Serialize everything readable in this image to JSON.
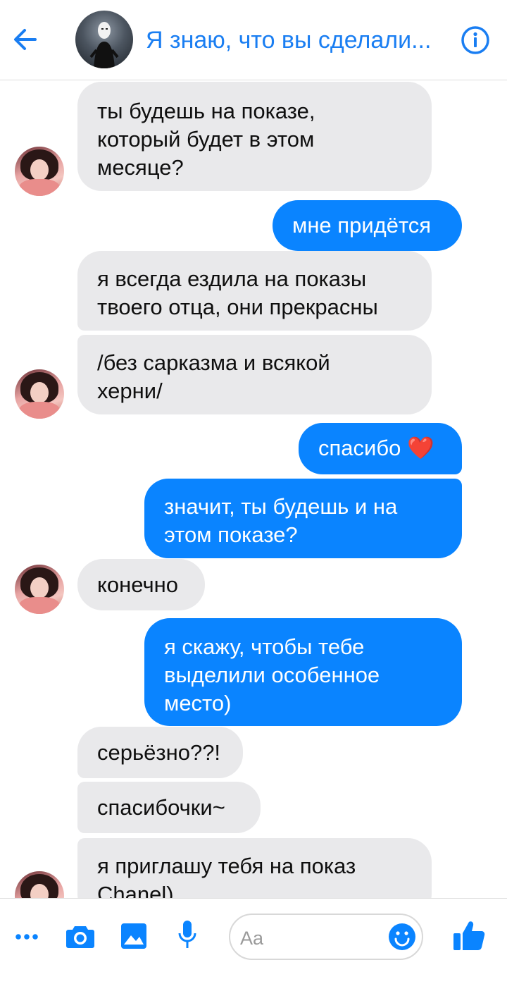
{
  "header": {
    "title": "Я знаю, что вы сделали..."
  },
  "icons": {
    "back": "arrow-left-icon",
    "info": "info-icon",
    "more": "more-dots-icon",
    "camera": "camera-icon",
    "gallery": "image-icon",
    "mic": "microphone-icon",
    "emoji": "smiley-icon",
    "like": "thumbs-up-icon"
  },
  "colors": {
    "accent": "#0a84ff",
    "incoming_bubble": "#e9e9eb",
    "outgoing_text": "#ffffff"
  },
  "messages": [
    {
      "from": "them",
      "text": "ты будешь на показе,\nкоторый будет в этом\nмесяце?"
    },
    {
      "from": "me",
      "text": "мне придётся"
    },
    {
      "from": "them",
      "text": "я всегда ездила на показы\nтвоего отца, они прекрасны"
    },
    {
      "from": "them",
      "text": "/без сарказма и всякой\nхерни/"
    },
    {
      "from": "me",
      "text": "спасибо ❤️"
    },
    {
      "from": "me",
      "text": "значит, ты будешь и на\nэтом показе?"
    },
    {
      "from": "them",
      "text": "конечно"
    },
    {
      "from": "me",
      "text": "я скажу, чтобы тебе\nвыделили особенное\nместо)"
    },
    {
      "from": "them",
      "text": "серьёзно??!"
    },
    {
      "from": "them",
      "text": "спасибочки~"
    },
    {
      "from": "them",
      "text": "я приглашу тебя на показ\nChanel)"
    }
  ],
  "composer": {
    "placeholder": "Aa"
  }
}
